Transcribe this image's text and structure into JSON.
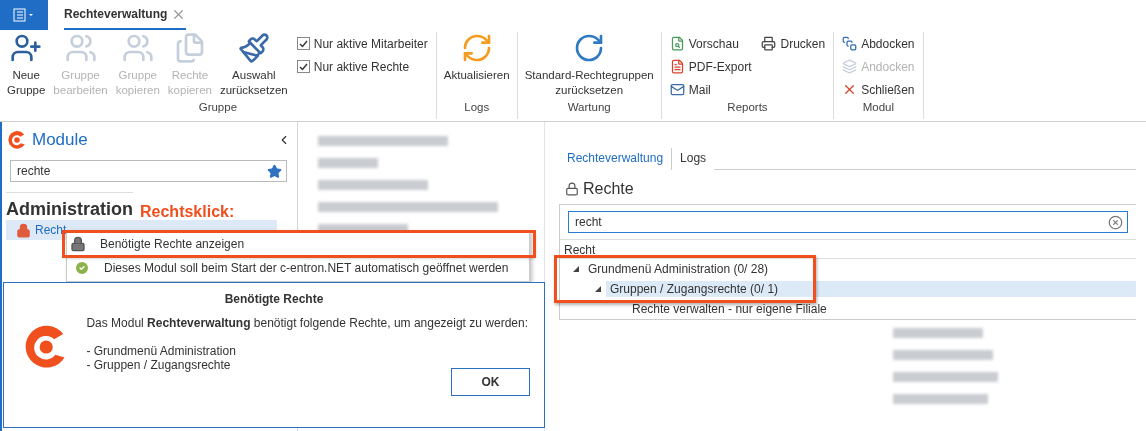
{
  "document_tab": {
    "label": "Rechteverwaltung",
    "selected": true
  },
  "ribbon": {
    "groups": [
      {
        "label": "Gruppe",
        "items": [
          {
            "kind": "large",
            "label": "Neue\nGruppe",
            "disabled": false
          },
          {
            "kind": "large",
            "label": "Gruppe\nbearbeiten",
            "disabled": true
          },
          {
            "kind": "large",
            "label": "Gruppe\nkopieren",
            "disabled": true
          },
          {
            "kind": "large",
            "label": "Rechte\nkopieren",
            "disabled": true
          },
          {
            "kind": "large",
            "label": "Auswahl\nzurücksetzen",
            "disabled": false
          },
          {
            "kind": "checkbox",
            "label": "Nur aktive Mitarbeiter",
            "checked": true
          },
          {
            "kind": "checkbox",
            "label": "Nur aktive Rechte",
            "checked": true
          }
        ]
      },
      {
        "label": "Logs",
        "items": [
          {
            "kind": "large",
            "label": "Aktualisieren",
            "disabled": false
          }
        ]
      },
      {
        "label": "Wartung",
        "items": [
          {
            "kind": "large",
            "label": "Standard-Rechtegruppen\nzurücksetzen",
            "disabled": false
          }
        ]
      },
      {
        "label": "Reports",
        "items": [
          {
            "kind": "small",
            "label": "Vorschau",
            "disabled": false
          },
          {
            "kind": "small",
            "label": "PDF-Export",
            "disabled": false
          },
          {
            "kind": "small",
            "label": "Mail",
            "disabled": false
          },
          {
            "kind": "small",
            "label": "Drucken",
            "disabled": false
          }
        ]
      },
      {
        "label": "Modul",
        "items": [
          {
            "kind": "small",
            "label": "Abdocken",
            "disabled": false
          },
          {
            "kind": "small",
            "label": "Andocken",
            "disabled": true
          },
          {
            "kind": "small",
            "label": "Schließen",
            "disabled": false
          }
        ]
      }
    ]
  },
  "module_panel": {
    "title": "Module",
    "search": {
      "value": "rechte"
    },
    "section": "Administration",
    "items": [
      {
        "label": "Recht",
        "selected": true
      }
    ]
  },
  "annotation": {
    "label": "Rechtsklick:"
  },
  "context_menu": {
    "items": [
      {
        "label": "Benötigte Rechte anzeigen",
        "highlighted": true
      },
      {
        "label": "Dieses Modul soll beim Start der c-entron.NET automatisch geöffnet werden",
        "highlighted": false
      }
    ]
  },
  "dialog": {
    "title": "Benötigte Rechte",
    "message": "Das Modul **Rechteverwaltung** benötigt folgende Rechte, um angezeigt zu werden:",
    "list": [
      "- Grundmenü Administration",
      "- Gruppen / Zugangsrechte"
    ],
    "button": "OK"
  },
  "rights_panel": {
    "tabs": [
      {
        "label": "Rechteverwaltung",
        "selected": true
      },
      {
        "label": "Logs",
        "selected": false
      }
    ],
    "heading": "Rechte",
    "search": {
      "value": "recht"
    },
    "column": "Recht",
    "tree": [
      {
        "label": "Grundmenü Administration (0/ 28)",
        "expanded": true,
        "selected": false,
        "highlighted": true,
        "children": [
          {
            "label": "Gruppen / Zugangsrechte (0/ 1)",
            "expanded": true,
            "selected": true,
            "highlighted": true,
            "children": [
              {
                "label": "Rechte verwalten - nur eigene Filiale",
                "selected": false,
                "highlighted": false
              }
            ]
          }
        ]
      }
    ]
  }
}
